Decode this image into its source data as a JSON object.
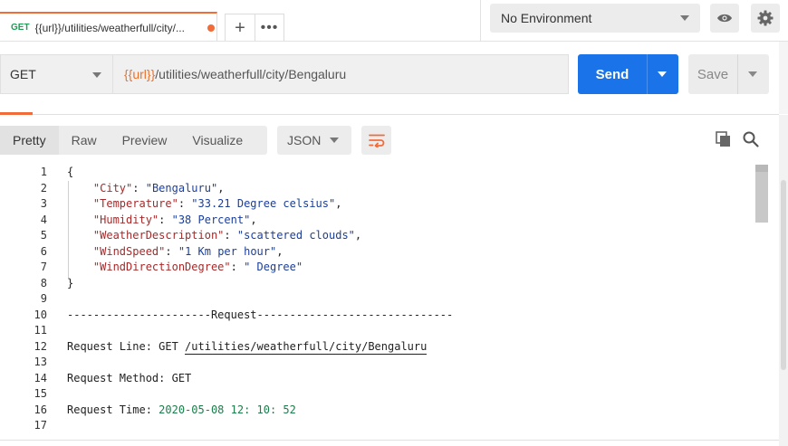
{
  "tab": {
    "method": "GET",
    "title": "{{url}}/utilities/weatherfull/city/..."
  },
  "environment": {
    "selected": "No Environment"
  },
  "request": {
    "method": "GET",
    "url_var": "{{url}}",
    "url_path": "/utilities/weatherfull/city/Bengaluru",
    "send_label": "Send",
    "save_label": "Save"
  },
  "response_toolbar": {
    "tabs": [
      "Pretty",
      "Raw",
      "Preview",
      "Visualize"
    ],
    "format": "JSON"
  },
  "response_body": {
    "line_numbers": [
      "1",
      "2",
      "3",
      "4",
      "5",
      "6",
      "7",
      "8",
      "9",
      "10",
      "11",
      "12",
      "13",
      "14",
      "15",
      "16",
      "17"
    ],
    "open_brace": "{",
    "close_brace": "}",
    "fields": [
      {
        "key": "\"City\"",
        "value": "\"Bengaluru\"",
        "sep": ","
      },
      {
        "key": "\"Temperature\"",
        "value": "\"33.21 Degree celsius\"",
        "sep": ","
      },
      {
        "key": "\"Humidity\"",
        "value": "\"38 Percent\"",
        "sep": ","
      },
      {
        "key": "\"WeatherDescription\"",
        "value": "\"scattered clouds\"",
        "sep": ","
      },
      {
        "key": "\"WindSpeed\"",
        "value": "\"1 Km per hour\"",
        "sep": ","
      },
      {
        "key": "\"WindDirectionDegree\"",
        "value": "\" Degree\"",
        "sep": ""
      }
    ],
    "separator_line": "----------------------Request------------------------------",
    "request_line_label": "Request Line: GET ",
    "request_line_path": "/utilities/weatherfull/city/Bengaluru",
    "request_method_line": "Request Method: GET",
    "request_time_label": "Request Time: ",
    "request_time_value": "2020-05-08 12: 10: 52"
  },
  "colors": {
    "accent": "#f26b3a",
    "send": "#1a73e8",
    "method_get": "#1f9d55",
    "json_key": "#a52a2a",
    "json_string": "#1a3e9c"
  }
}
